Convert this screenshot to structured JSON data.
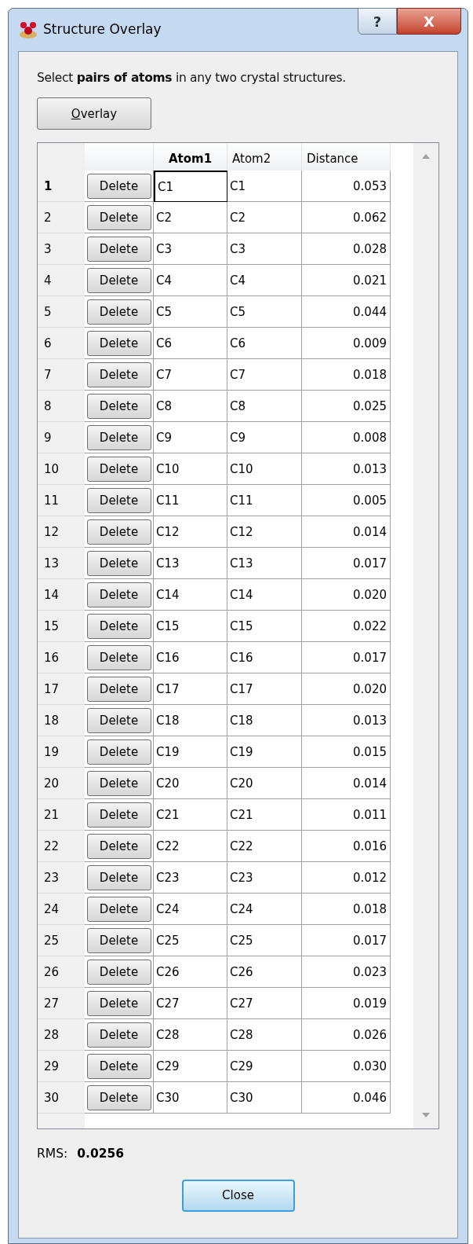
{
  "window": {
    "title": "Structure Overlay",
    "help_button": "?",
    "close_button": "X"
  },
  "instruction": "Select **pairs of atoms** in any two crystal structures.",
  "overlay_button": {
    "mnemonic": "O",
    "label_rest": "verlay"
  },
  "table": {
    "columns": [
      {
        "label": "Atom1",
        "selected": true
      },
      {
        "label": "Atom2",
        "selected": false
      },
      {
        "label": "Distance",
        "selected": false
      }
    ],
    "rows": [
      {
        "number": "1",
        "button": "Delete",
        "atom1": "C1",
        "atom2": "C1",
        "distance": "0.053",
        "selected": true
      },
      {
        "number": "2",
        "button": "Delete",
        "atom1": "C2",
        "atom2": "C2",
        "distance": "0.062",
        "selected": false
      },
      {
        "number": "3",
        "button": "Delete",
        "atom1": "C3",
        "atom2": "C3",
        "distance": "0.028",
        "selected": false
      },
      {
        "number": "4",
        "button": "Delete",
        "atom1": "C4",
        "atom2": "C4",
        "distance": "0.021",
        "selected": false
      },
      {
        "number": "5",
        "button": "Delete",
        "atom1": "C5",
        "atom2": "C5",
        "distance": "0.044",
        "selected": false
      },
      {
        "number": "6",
        "button": "Delete",
        "atom1": "C6",
        "atom2": "C6",
        "distance": "0.009",
        "selected": false
      },
      {
        "number": "7",
        "button": "Delete",
        "atom1": "C7",
        "atom2": "C7",
        "distance": "0.018",
        "selected": false
      },
      {
        "number": "8",
        "button": "Delete",
        "atom1": "C8",
        "atom2": "C8",
        "distance": "0.025",
        "selected": false
      },
      {
        "number": "9",
        "button": "Delete",
        "atom1": "C9",
        "atom2": "C9",
        "distance": "0.008",
        "selected": false
      },
      {
        "number": "10",
        "button": "Delete",
        "atom1": "C10",
        "atom2": "C10",
        "distance": "0.013",
        "selected": false
      },
      {
        "number": "11",
        "button": "Delete",
        "atom1": "C11",
        "atom2": "C11",
        "distance": "0.005",
        "selected": false
      },
      {
        "number": "12",
        "button": "Delete",
        "atom1": "C12",
        "atom2": "C12",
        "distance": "0.014",
        "selected": false
      },
      {
        "number": "13",
        "button": "Delete",
        "atom1": "C13",
        "atom2": "C13",
        "distance": "0.017",
        "selected": false
      },
      {
        "number": "14",
        "button": "Delete",
        "atom1": "C14",
        "atom2": "C14",
        "distance": "0.020",
        "selected": false
      },
      {
        "number": "15",
        "button": "Delete",
        "atom1": "C15",
        "atom2": "C15",
        "distance": "0.022",
        "selected": false
      },
      {
        "number": "16",
        "button": "Delete",
        "atom1": "C16",
        "atom2": "C16",
        "distance": "0.017",
        "selected": false
      },
      {
        "number": "17",
        "button": "Delete",
        "atom1": "C17",
        "atom2": "C17",
        "distance": "0.020",
        "selected": false
      },
      {
        "number": "18",
        "button": "Delete",
        "atom1": "C18",
        "atom2": "C18",
        "distance": "0.013",
        "selected": false
      },
      {
        "number": "19",
        "button": "Delete",
        "atom1": "C19",
        "atom2": "C19",
        "distance": "0.015",
        "selected": false
      },
      {
        "number": "20",
        "button": "Delete",
        "atom1": "C20",
        "atom2": "C20",
        "distance": "0.014",
        "selected": false
      },
      {
        "number": "21",
        "button": "Delete",
        "atom1": "C21",
        "atom2": "C21",
        "distance": "0.011",
        "selected": false
      },
      {
        "number": "22",
        "button": "Delete",
        "atom1": "C22",
        "atom2": "C22",
        "distance": "0.016",
        "selected": false
      },
      {
        "number": "23",
        "button": "Delete",
        "atom1": "C23",
        "atom2": "C23",
        "distance": "0.012",
        "selected": false
      },
      {
        "number": "24",
        "button": "Delete",
        "atom1": "C24",
        "atom2": "C24",
        "distance": "0.018",
        "selected": false
      },
      {
        "number": "25",
        "button": "Delete",
        "atom1": "C25",
        "atom2": "C25",
        "distance": "0.017",
        "selected": false
      },
      {
        "number": "26",
        "button": "Delete",
        "atom1": "C26",
        "atom2": "C26",
        "distance": "0.023",
        "selected": false
      },
      {
        "number": "27",
        "button": "Delete",
        "atom1": "C27",
        "atom2": "C27",
        "distance": "0.019",
        "selected": false
      },
      {
        "number": "28",
        "button": "Delete",
        "atom1": "C28",
        "atom2": "C28",
        "distance": "0.026",
        "selected": false
      },
      {
        "number": "29",
        "button": "Delete",
        "atom1": "C29",
        "atom2": "C29",
        "distance": "0.030",
        "selected": false
      },
      {
        "number": "30",
        "button": "Delete",
        "atom1": "C30",
        "atom2": "C30",
        "distance": "0.046",
        "selected": false
      }
    ]
  },
  "rms": {
    "label": "RMS:",
    "value": "0.0256"
  },
  "close_button": "Close"
}
